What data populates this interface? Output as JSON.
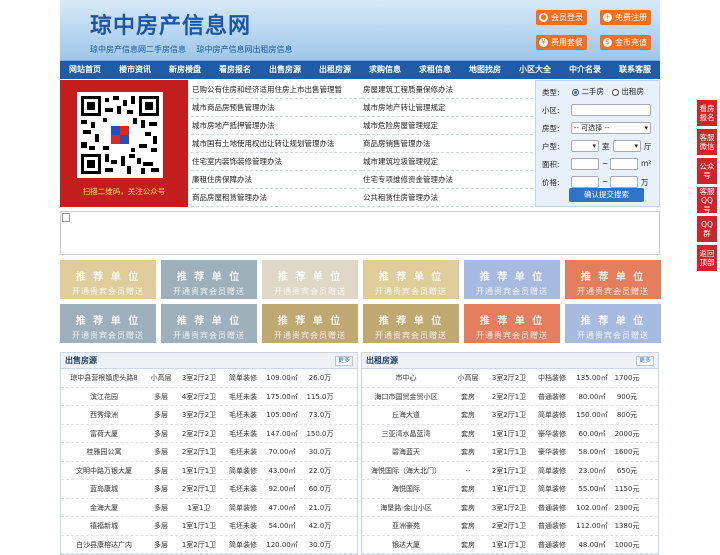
{
  "header": {
    "logo": "琼中房产信息网",
    "slogans": [
      "琼中房产信息网二手房信息",
      "琼中房产信息网出租房信息"
    ],
    "buttons": [
      {
        "label": "会员登录",
        "icon": "user-icon",
        "glyph": "●"
      },
      {
        "label": "免费注册",
        "icon": "person-add-icon",
        "glyph": "+"
      },
      {
        "label": "费用套餐",
        "icon": "coins-icon",
        "glyph": "¥"
      },
      {
        "label": "金币充值",
        "icon": "gold-icon",
        "glyph": "$"
      }
    ]
  },
  "nav": [
    "网站首页",
    "楼市资讯",
    "新房楼盘",
    "看房报名",
    "出售房源",
    "出租房源",
    "求购信息",
    "求租信息",
    "地图找房",
    "小区大全",
    "中介名录",
    "联系客服"
  ],
  "qr": {
    "caption": "扫描二维码，关注公众号"
  },
  "links": {
    "left": [
      "已购公有住房和经济适用住房上市出售管理暂",
      "城市商品房预售管理办法",
      "城市房地产抵押管理办法",
      "城市国有土地使用权出让转让规划管理办法",
      "住宅室内装饰装修管理办法",
      "廉租住房保障办法",
      "商品房屋租赁管理办法"
    ],
    "right": [
      "房屋建筑工程质量保修办法",
      "城市房地产转让管理规定",
      "城市危险房屋管理规定",
      "商品房销售管理办法",
      "城市建筑垃圾管理规定",
      "住宅专项维修资金管理办法",
      "公共租赁住房管理办法"
    ]
  },
  "search": {
    "type_label": "类型:",
    "opt_sale": "二手房",
    "opt_rent": "出租房",
    "community_label": "小区:",
    "house_label": "房型:",
    "house_select": "-- 可选择 --",
    "layout_label": "户型:",
    "room": "室",
    "hall": "厅",
    "area_label": "面积:",
    "area_unit": "m²",
    "price_label": "价格:",
    "price_unit": "万",
    "submit": "确认提交搜索"
  },
  "tiles": {
    "t1": "推 荐 单 位",
    "t2": "开通贵宾会员赠送",
    "colors": [
      "#e0cd9c",
      "#9eb0ba",
      "#dfd7c7",
      "#e0cd9c",
      "#a7bbe0",
      "#e57e5c",
      "#9eb0ba",
      "#9eb0ba",
      "#bfa871",
      "#bfa871",
      "#e57e5c",
      "#a7bbe0"
    ]
  },
  "sale": {
    "title": "出售房源",
    "more": "更多",
    "rows": [
      [
        "琼中县营根镇虎头路8",
        "小高层",
        "3室2厅2卫",
        "简单装修",
        "109.00㎡",
        "26.0万"
      ],
      [
        "滨江花园",
        "多层",
        "4室2厅2卫",
        "毛坯未装",
        "175.00㎡",
        "115.0万"
      ],
      [
        "西秀绿洲",
        "多层",
        "3室2厅2卫",
        "毛坯未装",
        "105.00㎡",
        "73.0万"
      ],
      [
        "富荷大厦",
        "多层",
        "2室2厅2卫",
        "毛坯未装",
        "147.00㎡",
        "150.0万"
      ],
      [
        "桂雅园公寓",
        "多层",
        "2室2厅1卫",
        "毛坯未装",
        "70.00㎡",
        "30.0万"
      ],
      [
        "文明中路万银大厦",
        "多层",
        "1室1厅1卫",
        "简单装修",
        "43.00㎡",
        "22.0万"
      ],
      [
        "蓝岛康城",
        "多层",
        "2室2厅1卫",
        "毛坯未装",
        "92.00㎡",
        "60.0万"
      ],
      [
        "金海大厦",
        "多层",
        "1室1卫",
        "简单装修",
        "47.00㎡",
        "21.0万"
      ],
      [
        "禧福新城",
        "多层",
        "1室1厅1卫",
        "毛坯未装",
        "54.00㎡",
        "42.0万"
      ],
      [
        "白沙县康榕达广内",
        "多层",
        "1室2厅1卫",
        "简单装修",
        "120.00㎡",
        "30.0万"
      ]
    ]
  },
  "rent": {
    "title": "出租房源",
    "more": "更多",
    "rows": [
      [
        "市中心",
        "小高层",
        "3室2厅2卫",
        "中档装修",
        "135.00㎡",
        "1700元"
      ],
      [
        "海口市国贸金贸小区",
        "套房",
        "2室2厅1卫",
        "普通装修",
        "80.00㎡",
        "900元"
      ],
      [
        "丘海大道",
        "套房",
        "3室2厅1卫",
        "简单装修",
        "150.00㎡",
        "800元"
      ],
      [
        "三亚湾水晶蓝湾",
        "套房",
        "1室1厅1卫",
        "豪华装修",
        "60.00㎡",
        "2000元"
      ],
      [
        "碧海蓝天",
        "套房",
        "1室1厅1卫",
        "豪华装修",
        "58.00㎡",
        "1600元"
      ],
      [
        "海悦国际（海大北门）",
        "--",
        "2室1厅1卫",
        "简单装修",
        "23.00㎡",
        "650元"
      ],
      [
        "海悦国际",
        "套房",
        "1室1厅1卫",
        "简单装修",
        "55.00㎡",
        "1150元"
      ],
      [
        "海垦路-金山小区",
        "套房",
        "3室1厅2卫",
        "普通装修",
        "102.00㎡",
        "2300元"
      ],
      [
        "亚洲豪苑",
        "套房",
        "2室2厅1卫",
        "普通装修",
        "112.00㎡",
        "1380元"
      ],
      [
        "银达大厦",
        "套房",
        "1室1厅1卫",
        "普通装修",
        "48.00㎡",
        "1000元"
      ]
    ]
  },
  "sidebar": [
    "看房报名",
    "客服微信",
    "公众号",
    "客服QQ号",
    "QQ群",
    "返回顶部"
  ]
}
